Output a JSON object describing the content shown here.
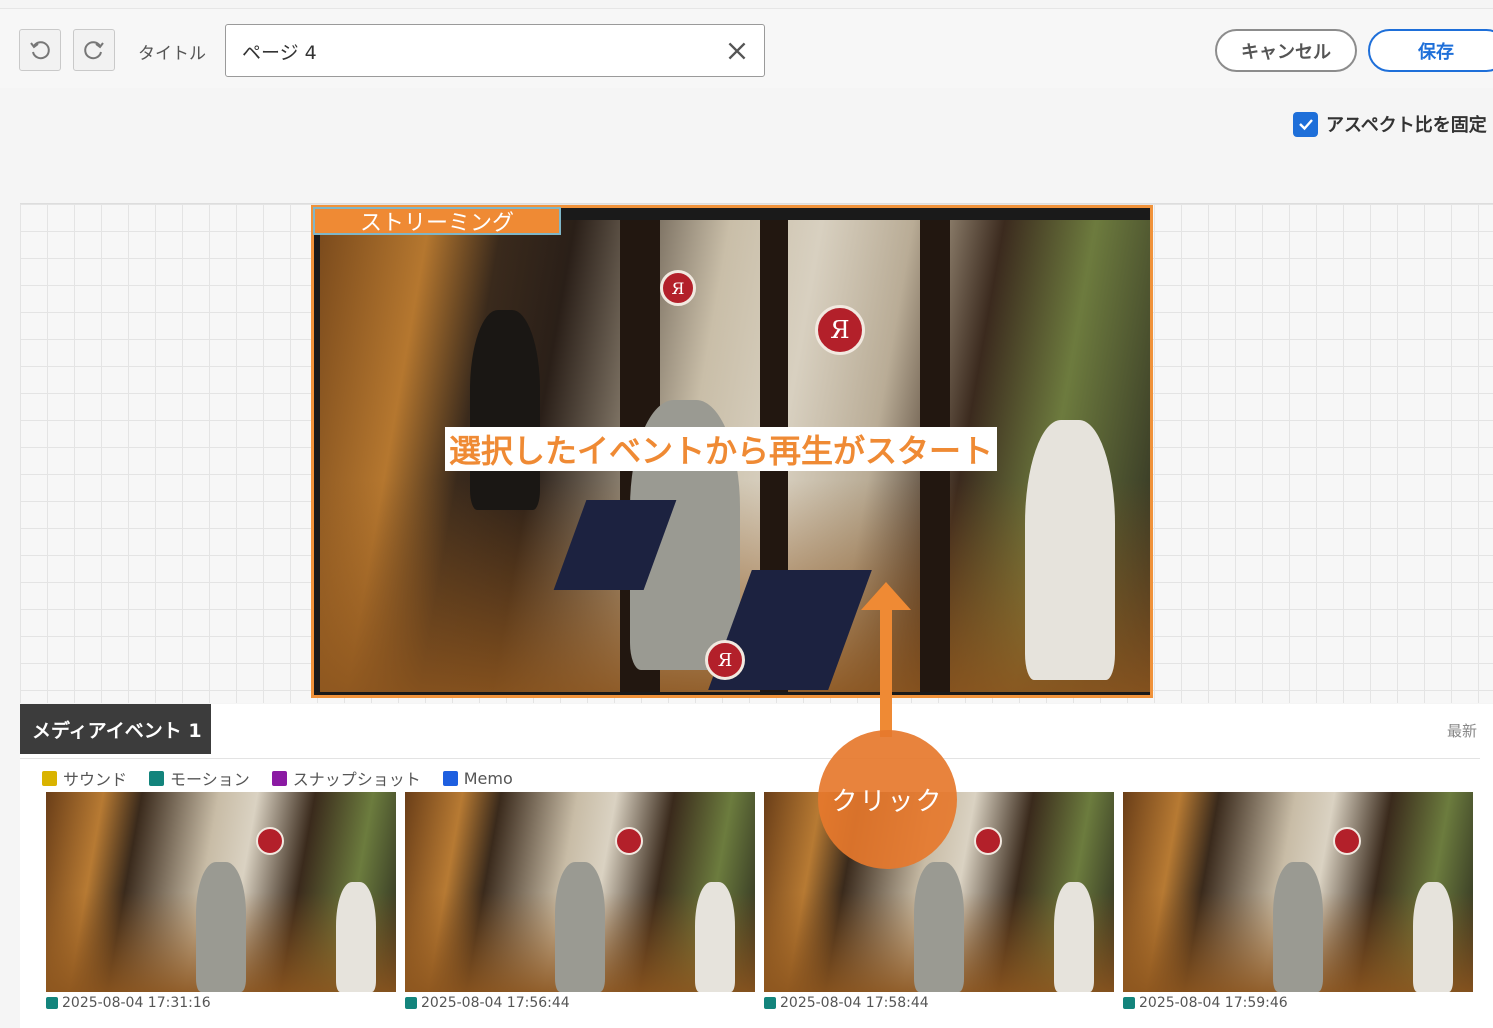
{
  "toolbar": {
    "undo_icon": "undo-icon",
    "redo_icon": "redo-icon",
    "title_label": "タイトル",
    "title_value": "ページ 4",
    "cancel_label": "キャンセル",
    "save_label": "保存"
  },
  "aspect_lock": {
    "label": "アスペクト比を固定",
    "checked": true
  },
  "stream_widget": {
    "tag_label": "ストリーミング",
    "caption": "選択したイベントから再生がスタート"
  },
  "events_panel": {
    "tab_label": "メディアイベント 1",
    "latest_label": "最新",
    "legend": [
      {
        "label": "サウンド",
        "color": "#d9b300"
      },
      {
        "label": "モーション",
        "color": "#13847c"
      },
      {
        "label": "スナップショット",
        "color": "#8b1aa3"
      },
      {
        "label": "Memo",
        "color": "#1e5fe0"
      }
    ],
    "thumbnails": [
      {
        "timestamp": "2025-08-04 17:31:16",
        "type_color": "#13847c"
      },
      {
        "timestamp": "2025-08-04 17:56:44",
        "type_color": "#13847c"
      },
      {
        "timestamp": "2025-08-04 17:58:44",
        "type_color": "#13847c"
      },
      {
        "timestamp": "2025-08-04 17:59:46",
        "type_color": "#13847c"
      }
    ]
  },
  "annotation": {
    "click_label": "クリック",
    "accent_color": "#ef8a34"
  }
}
